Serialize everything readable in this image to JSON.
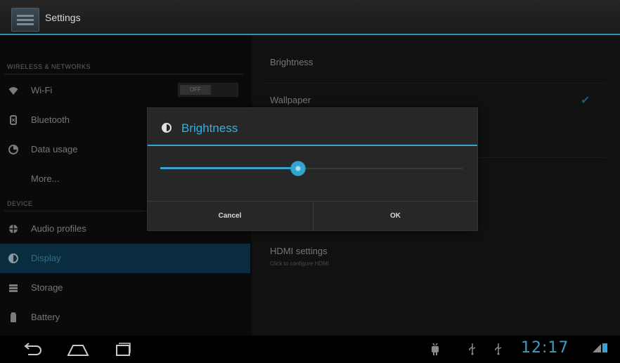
{
  "action_bar": {
    "title": "Settings"
  },
  "sidebar": {
    "sections": [
      {
        "header": "WIRELESS & NETWORKS"
      },
      {
        "header": "DEVICE"
      }
    ],
    "items": [
      {
        "label": "Wi-Fi",
        "icon": "wifi-icon",
        "toggle": "OFF"
      },
      {
        "label": "Bluetooth",
        "icon": "bluetooth-icon"
      },
      {
        "label": "Data usage",
        "icon": "data-usage-icon"
      },
      {
        "label": "More..."
      },
      {
        "label": "Audio profiles",
        "icon": "audio-profiles-icon"
      },
      {
        "label": "Display",
        "icon": "display-icon",
        "selected": true
      },
      {
        "label": "Storage",
        "icon": "storage-icon"
      },
      {
        "label": "Battery",
        "icon": "battery-icon"
      }
    ]
  },
  "display_prefs": {
    "brightness": "Brightness",
    "wallpaper": "Wallpaper",
    "hdmi_title": "HDMI settings",
    "hdmi_summary": "Click to configure HDMI"
  },
  "dialog": {
    "title": "Brightness",
    "icon": "brightness-icon",
    "brightness_level": 0.455,
    "cancel_label": "Cancel",
    "ok_label": "OK"
  },
  "system_bar": {
    "clock": "12:17",
    "nav": [
      "back-icon",
      "home-icon",
      "recent-apps-icon"
    ],
    "status_icons": [
      "android-debug-icon",
      "usb-icon",
      "usb-icon",
      "signal-icon",
      "battery-icon"
    ]
  },
  "colors": {
    "accent": "#33a5cf",
    "selected_bg": "#0f4662"
  }
}
